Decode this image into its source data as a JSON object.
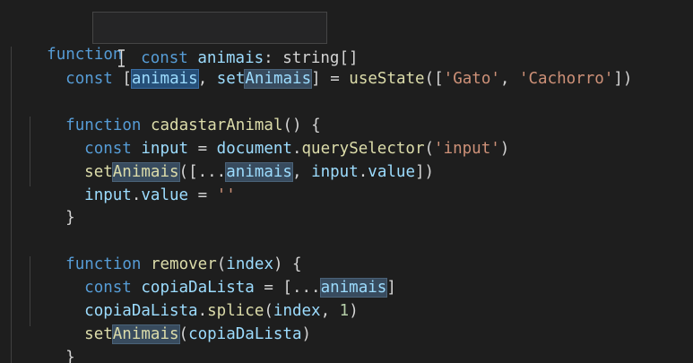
{
  "hover": {
    "keyword": "const",
    "name": "animais",
    "type": ": string[]"
  },
  "code": {
    "l1": {
      "kw": "function"
    },
    "l2": {
      "kw": "const",
      "open": " [",
      "var1": "animais",
      "sep": ", ",
      "set_prefix": "set",
      "set_hl": "Animais",
      "close": "] = ",
      "fn": "useState",
      "args_open": "([",
      "s1": "'Gato'",
      "comma": ", ",
      "s2": "'Cachorro'",
      "args_close": "])"
    },
    "l4": {
      "kw": "function",
      "fn": " cadastarAnimal",
      "rest": "() {"
    },
    "l5": {
      "kw": "const",
      "var": " input",
      "eq": " = ",
      "obj": "document",
      "dot": ".",
      "fn": "querySelector",
      "p1": "(",
      "str": "'input'",
      "p2": ")"
    },
    "l6": {
      "fn_prefix": "set",
      "fn_hl": "Animais",
      "open": "([...",
      "var1": "animais",
      "sep": ", ",
      "obj": "input",
      "dot": ".",
      "prop": "value",
      "close": "])"
    },
    "l7": {
      "obj": "input",
      "dot": ".",
      "prop": "value",
      "eq": " = ",
      "str": "''"
    },
    "l8": {
      "brace": "}"
    },
    "l10": {
      "kw": "function",
      "fn": " remover",
      "p1": "(",
      "param": "index",
      "p2": ") {"
    },
    "l11": {
      "kw": "const",
      "var": " copiaDaLista",
      "eq": " = [...",
      "var2": "animais",
      "close": "]"
    },
    "l12": {
      "obj": "copiaDaLista",
      "dot": ".",
      "fn": "splice",
      "p1": "(",
      "param": "index",
      "sep": ", ",
      "num": "1",
      "p2": ")"
    },
    "l13": {
      "fn_prefix": "set",
      "fn_hl": "Animais",
      "p1": "(",
      "arg": "copiaDaLista",
      "p2": ")"
    },
    "l14": {
      "brace": "}"
    }
  },
  "colors": {
    "background": "#1e1e1e",
    "keyword": "#569cd6",
    "function": "#dcdcaa",
    "variable": "#9cdcfe",
    "string": "#ce9178",
    "number": "#b5cea8",
    "selection": "#264f78"
  }
}
